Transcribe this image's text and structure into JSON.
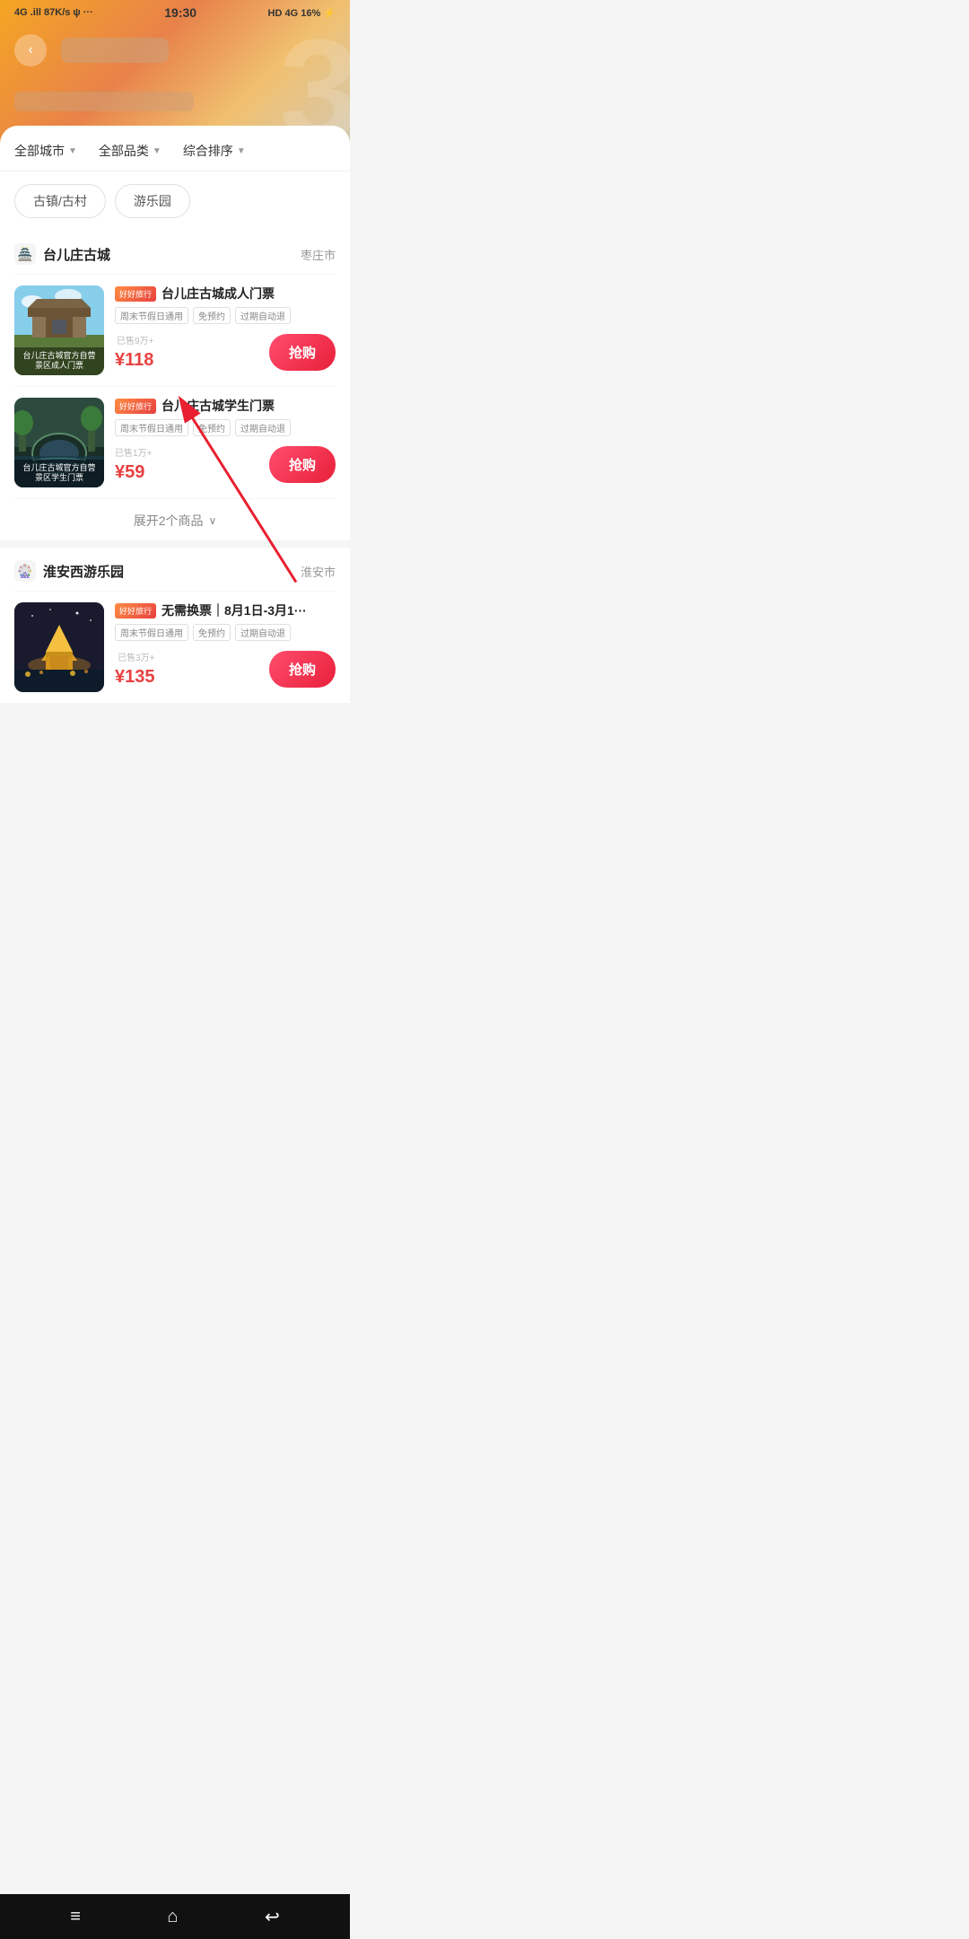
{
  "statusBar": {
    "left": "4G .ill 87K/s ψ ···",
    "center": "19:30",
    "right": "HD 4G 16% ⚡"
  },
  "header": {
    "backLabel": "‹",
    "titlePlaceholder": "",
    "subtitlePlaceholder": ""
  },
  "filters": [
    {
      "label": "全部城市",
      "id": "city"
    },
    {
      "label": "全部品类",
      "id": "category"
    },
    {
      "label": "综合排序",
      "id": "sort"
    }
  ],
  "categoryTabs": [
    {
      "label": "古镇/古村",
      "active": false
    },
    {
      "label": "游乐园",
      "active": false
    }
  ],
  "venues": [
    {
      "id": "taierzhuang",
      "name": "台儿庄古城",
      "city": "枣庄市",
      "products": [
        {
          "id": "adult",
          "title": "台儿庄古城成人门票",
          "brandBadge": "好好旅行",
          "tags": [
            "周末节假日通用",
            "免预约",
            "过期自动退"
          ],
          "price": "¥118",
          "soldCount": "已售9万+",
          "btnLabel": "抢购",
          "imgLabel1": "台儿庄古城官方自营",
          "imgLabel2": "景区成人门票"
        },
        {
          "id": "student",
          "title": "台儿庄古城学生门票",
          "brandBadge": "好好旅行",
          "tags": [
            "周末节假日通用",
            "免预约",
            "过期自动退"
          ],
          "price": "¥59",
          "soldCount": "已售1万+",
          "btnLabel": "抢购",
          "imgLabel1": "台儿庄古城官方自营",
          "imgLabel2": "景区学生门票"
        }
      ],
      "expandLabel": "展开2个商品",
      "expandIcon": "∨"
    },
    {
      "id": "huaian",
      "name": "淮安西游乐园",
      "city": "淮安市",
      "products": [
        {
          "id": "huaian-ticket",
          "title": "无需换票｜8月1日-3月1···",
          "brandBadge": "好好旅行",
          "tags": [
            "周末节假日通用",
            "免预约",
            "过期自动退"
          ],
          "price": "¥135",
          "soldCount": "已售3万+",
          "btnLabel": "抢购",
          "imgLabel1": "",
          "imgLabel2": ""
        }
      ]
    }
  ],
  "bottomNav": {
    "menuIcon": "≡",
    "homeIcon": "⌂",
    "backIcon": "↩"
  }
}
